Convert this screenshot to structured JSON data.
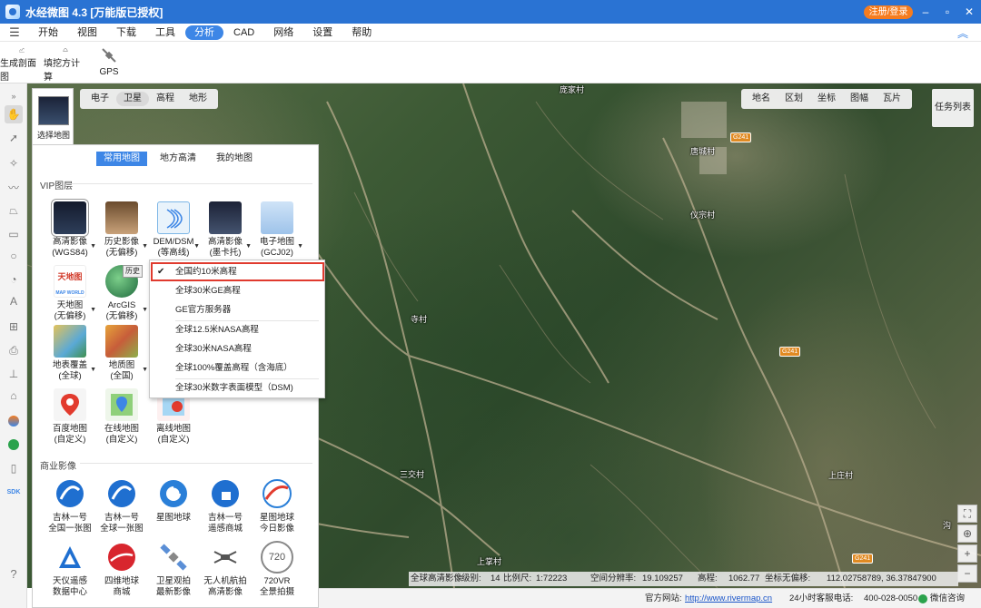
{
  "window": {
    "title": "水经微图 4.3 [万能版已授权]",
    "login_label": "注册/登录",
    "controls": [
      "–",
      "▫",
      "✕"
    ]
  },
  "menu": {
    "items": [
      "开始",
      "视图",
      "下载",
      "工具",
      "分析",
      "CAD",
      "网络",
      "设置",
      "帮助"
    ],
    "active": "分析"
  },
  "ribbon": {
    "buttons": [
      "生成剖面图",
      "填挖方计算",
      "GPS"
    ]
  },
  "map": {
    "top_tabs": [
      "电子",
      "卫星",
      "高程",
      "地形"
    ],
    "active_top_tab": "卫星",
    "right_tabs": [
      "地名",
      "区划",
      "坐标",
      "图幅",
      "瓦片"
    ],
    "task_list": "任务列表",
    "places": [
      "庞家村",
      "唐城村",
      "仪宗村",
      "寺村",
      "三交村",
      "上庄村",
      "上掌村",
      "沟"
    ],
    "road_badges": [
      "G241",
      "G241",
      "G241"
    ]
  },
  "select_map": {
    "label": "选择地图"
  },
  "panel": {
    "tabs": [
      "常用地图",
      "地方高清",
      "我的地图"
    ],
    "active_tab": "常用地图",
    "vip_section": "VIP图层",
    "commercial_section": "商业影像",
    "vip_tiles": [
      [
        "高清影像",
        "(WGS84)"
      ],
      [
        "历史影像",
        "(无偏移)"
      ],
      [
        "DEM/DSM",
        "(等高线)"
      ],
      [
        "高清影像",
        "(墨卡托)"
      ],
      [
        "电子地图",
        "(GCJ02)"
      ],
      [
        "天地图",
        "(无偏移)"
      ],
      [
        "ArcGIS",
        "(无偏移)"
      ],
      [
        "地表覆盖",
        "(全球)"
      ],
      [
        "地质图",
        "(全国)"
      ],
      [
        "百度地图",
        "(自定义)"
      ],
      [
        "在线地图",
        "(自定义)"
      ],
      [
        "离线地图",
        "(自定义)"
      ]
    ],
    "history_badge": "历史",
    "tianditu_logo": "天地图",
    "tianditu_sub": "MAP WORLD",
    "commercial_tiles": [
      [
        "吉林一号",
        "全国一张图"
      ],
      [
        "吉林一号",
        "全球一张图"
      ],
      [
        "星图地球",
        ""
      ],
      [
        "吉林一号",
        "遥感商城"
      ],
      [
        "星图地球",
        "今日影像"
      ],
      [
        "天仪遥感",
        "数据中心"
      ],
      [
        "四维地球",
        "商城"
      ],
      [
        "卫星观拍",
        "最新影像"
      ],
      [
        "无人机航拍",
        "高清影像"
      ],
      [
        "720VR",
        "全景拍摄"
      ]
    ],
    "vr_badge": "720"
  },
  "dropdown": {
    "items": [
      "全国约10米高程",
      "全球30米GE高程",
      "GE官方服务器",
      "全球12.5米NASA高程",
      "全球30米NASA高程",
      "全球100%覆盖高程（含海底）",
      "全球30米数字表面模型（DSM)"
    ],
    "checked_index": 0
  },
  "status": {
    "source": "全球高清影像",
    "level_label": "级别:",
    "level": "14",
    "scale_label": "比例尺:",
    "scale": "1:72223",
    "resolution_label": "空间分辨率:",
    "resolution": "19.109257",
    "elevation_label": "高程:",
    "elevation": "1062.77",
    "coord_label": "坐标无偏移:",
    "coords": "112.02758789, 36.37847900"
  },
  "footer": {
    "site_label": "官方网站:",
    "site_url": "http://www.rivermap.cn",
    "hotline": "24小时客服电话:",
    "phone": "400-028-0050",
    "wechat": "微信咨询"
  },
  "left_tools": [
    "sdk-label"
  ],
  "sdk_text": "SDK",
  "colors": {
    "titlebar": "#2a73d3",
    "accent": "#3d86e6",
    "login": "#f57c1f",
    "highlight_box": "#e03a2e"
  }
}
